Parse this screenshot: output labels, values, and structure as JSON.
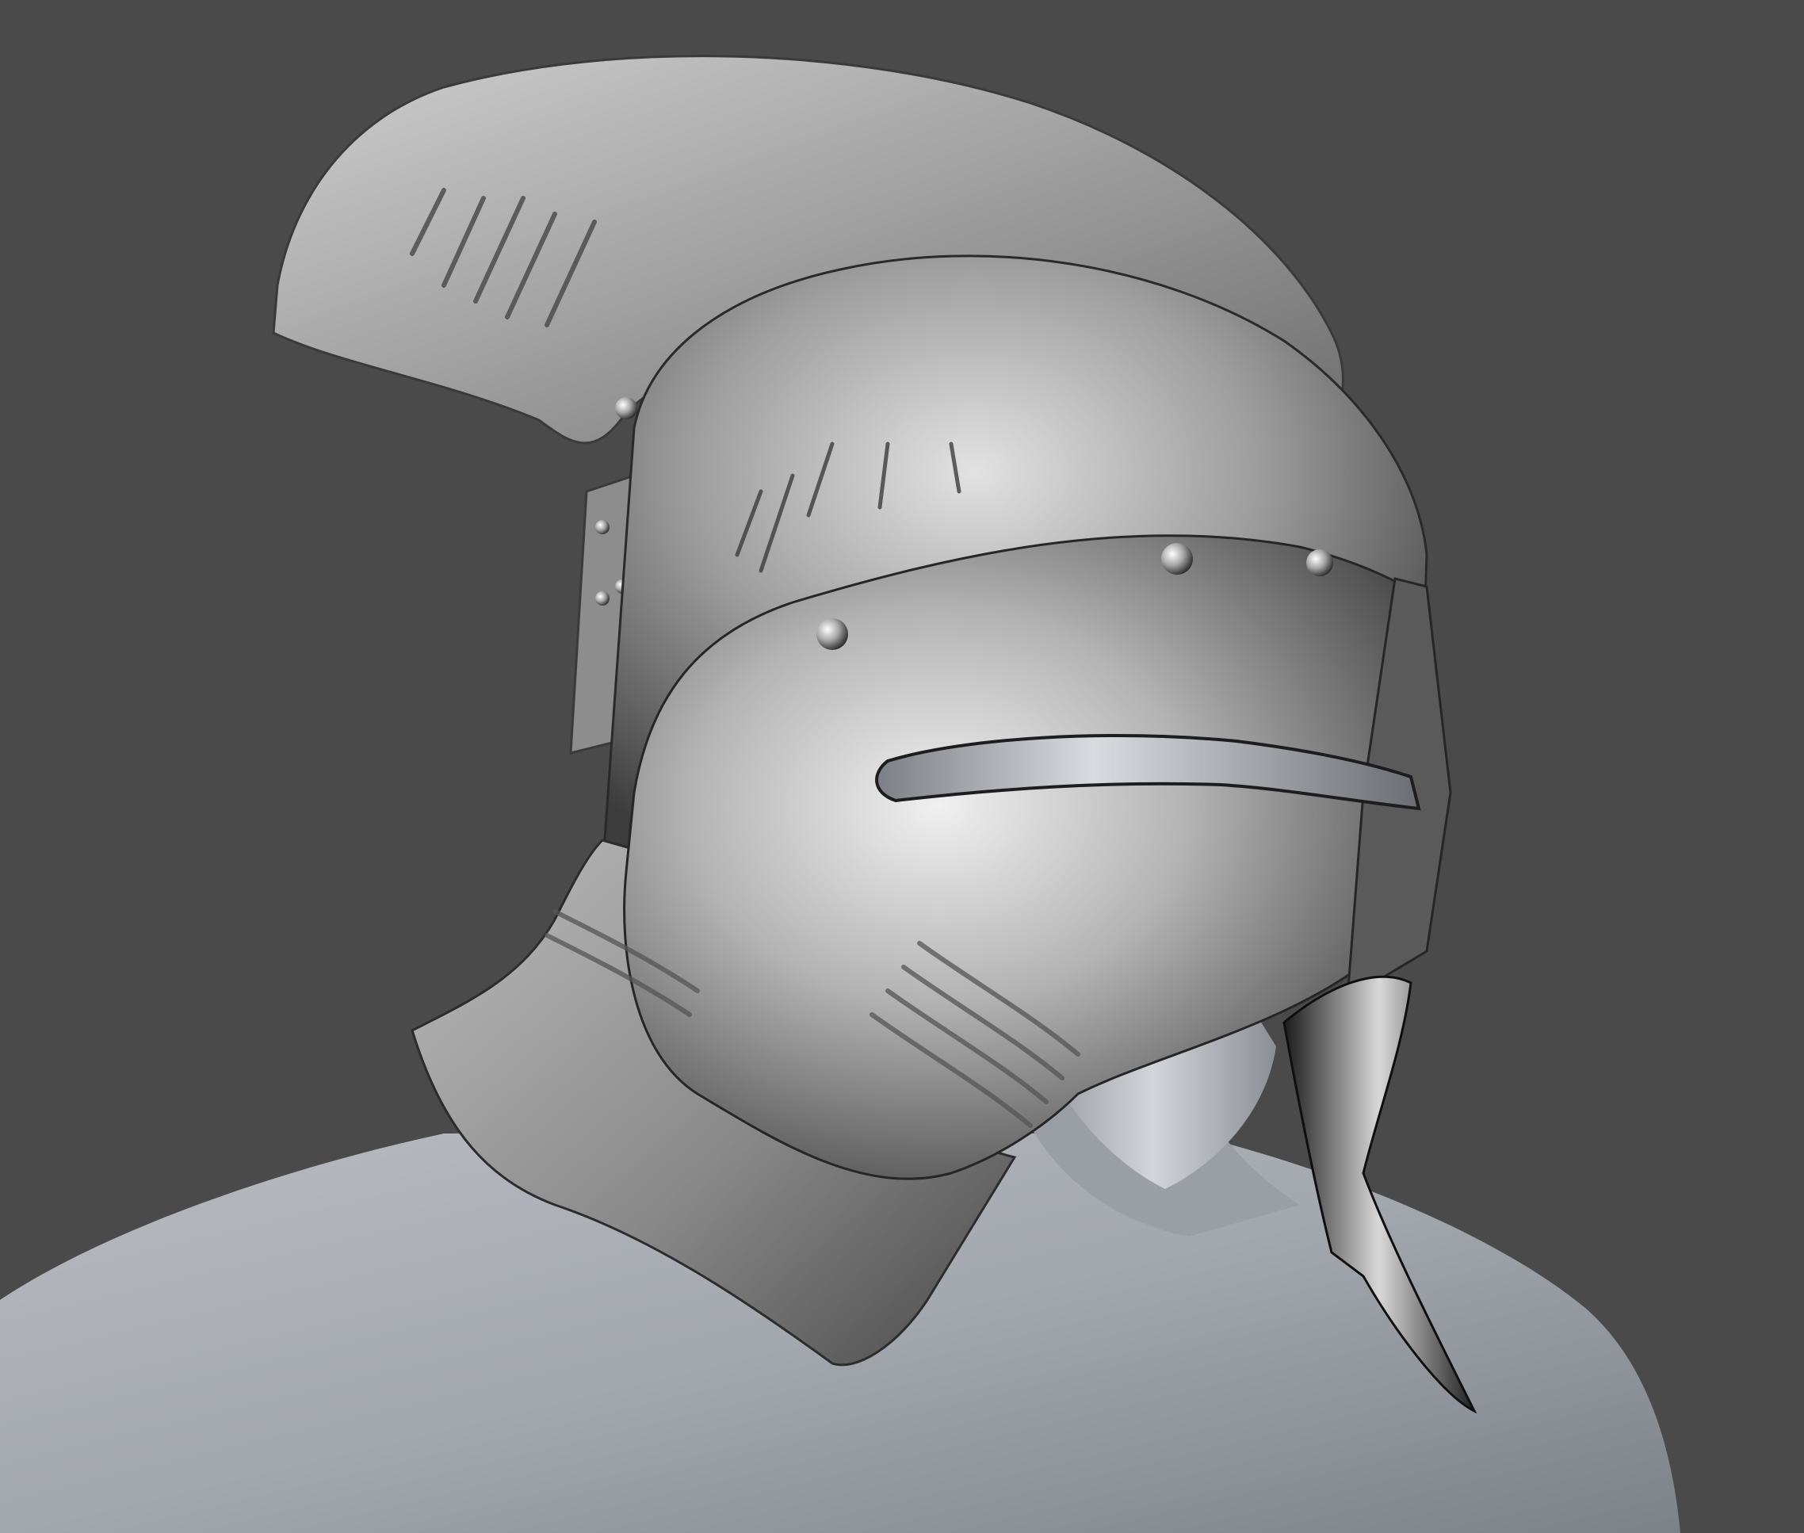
{
  "scene": {
    "subject": "helmet-render",
    "background_color": "#4a4a4a",
    "colors": {
      "metal_light": "#e6e6e6",
      "metal_mid": "#9a9a9a",
      "metal_dark": "#2e2e2e",
      "skin_light": "#cfd2d8",
      "skin_mid": "#a9adb4",
      "skin_dark": "#6f737a"
    }
  }
}
